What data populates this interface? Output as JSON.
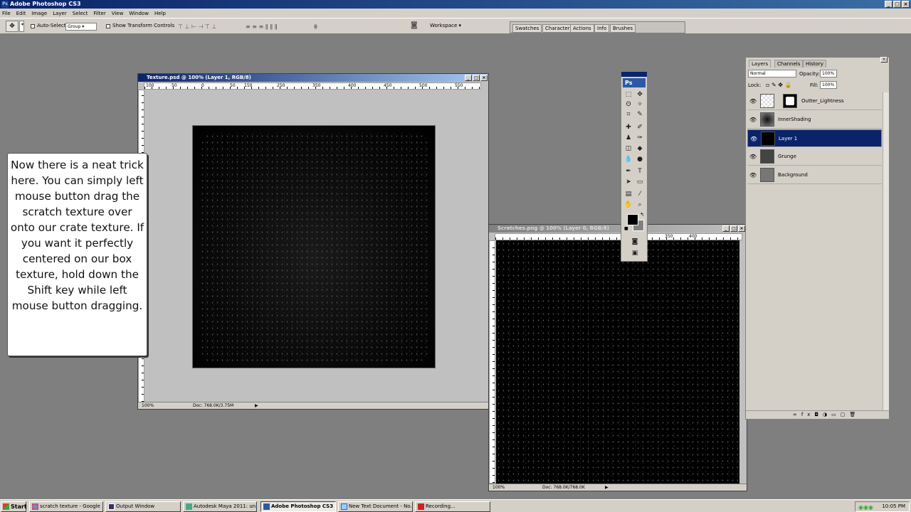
{
  "app": {
    "title": "Adobe Photoshop CS3"
  },
  "menu": [
    "File",
    "Edit",
    "Image",
    "Layer",
    "Select",
    "Filter",
    "View",
    "Window",
    "Help"
  ],
  "options": {
    "auto_select_label": "Auto-Select:",
    "auto_select_value": "Group",
    "transform_label": "Show Transform Controls",
    "workspace_label": "Workspace"
  },
  "panel_well": {
    "tabs": [
      "Swatches",
      "Character",
      "Actions",
      "Info",
      "Brushes"
    ]
  },
  "doc1": {
    "title": "Texture.psd @ 100% (Layer 1, RGB/8)",
    "zoom": "100%",
    "doc_info": "Doc: 768.0K/3.75M",
    "ruler": [
      "100",
      "50",
      "0",
      "50",
      "100",
      "150",
      "200",
      "250",
      "300",
      "350",
      "400",
      "450",
      "500",
      "550"
    ]
  },
  "doc2": {
    "title": "Scratches.png @ 100% (Layer 0, RGB/8)",
    "zoom": "100%",
    "doc_info": "Doc: 768.0K/768.0K",
    "ruler": [
      "350",
      "400"
    ]
  },
  "tooltip": {
    "text": "Now there is a neat trick here. You can simply left mouse button drag the scratch texture over onto our crate texture. If you want it perfectly centered on our box texture, hold down the Shift key while left mouse button dragging."
  },
  "toolbox": {
    "logo": "Ps"
  },
  "layers_panel": {
    "tabs": [
      "Layers",
      "Channels",
      "History"
    ],
    "blend_mode": "Normal",
    "opacity_label": "Opacity:",
    "opacity": "100%",
    "lock_label": "Lock:",
    "fill_label": "Fill:",
    "fill": "100%",
    "layers": [
      {
        "name": "Outter_Lightness",
        "selected": false
      },
      {
        "name": "InnerShading",
        "selected": false
      },
      {
        "name": "Layer 1",
        "selected": true
      },
      {
        "name": "Grunge",
        "selected": false
      },
      {
        "name": "Background",
        "selected": false
      }
    ]
  },
  "taskbar": {
    "start": "Start",
    "tasks": [
      "scratch texture - Google ...",
      "Output Window",
      "Autodesk Maya 2011: un...",
      "Adobe Photoshop CS3",
      "New Text Document - No...",
      "Recording..."
    ],
    "clock": "10:05 PM"
  },
  "colors": {
    "titlebar": "#0a246a",
    "selection": "#0a246a",
    "workspace": "#7f7f7f",
    "chrome": "#d4d0c8"
  }
}
